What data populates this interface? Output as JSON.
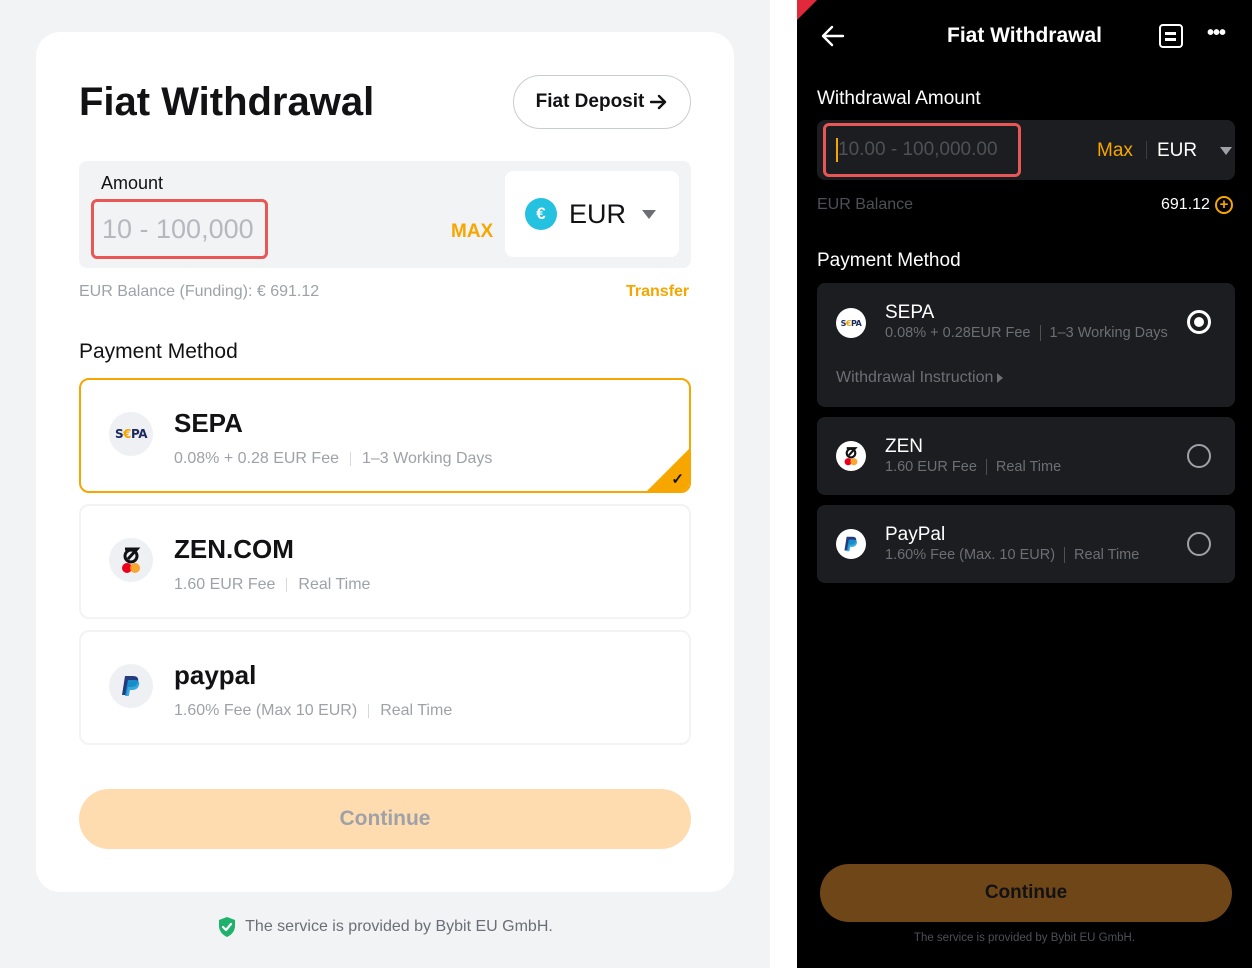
{
  "desktop": {
    "title": "Fiat Withdrawal",
    "deposit_button": "Fiat Deposit",
    "amount_label": "Amount",
    "amount_placeholder": "10 - 100,000",
    "max_label": "MAX",
    "currency_symbol": "€",
    "currency": "EUR",
    "balance_text": "EUR Balance (Funding): € 691.12",
    "transfer_link": "Transfer",
    "payment_method_title": "Payment Method",
    "methods": [
      {
        "name": "SEPA",
        "fee": "0.08% + 0.28 EUR Fee",
        "time": "1–3 Working Days",
        "selected": true,
        "icon": "sepa-logo-icon"
      },
      {
        "name": "ZEN.COM",
        "fee": "1.60 EUR Fee",
        "time": "Real Time",
        "selected": false,
        "icon": "zen-logo-icon"
      },
      {
        "name": "paypal",
        "fee": "1.60% Fee (Max 10 EUR)",
        "time": "Real Time",
        "selected": false,
        "icon": "paypal-logo-icon"
      }
    ],
    "continue_button": "Continue",
    "footer": "The service is provided by Bybit EU GmbH.",
    "accent_color": "#f7a600"
  },
  "mobile": {
    "title": "Fiat Withdrawal",
    "withdrawal_amount_label": "Withdrawal Amount",
    "amount_placeholder": "10.00 - 100,000.00",
    "max_label": "Max",
    "currency": "EUR",
    "balance_label": "EUR Balance",
    "balance_value": "691.12",
    "payment_method_title": "Payment Method",
    "methods": [
      {
        "name": "SEPA",
        "fee": "0.08% + 0.28EUR Fee",
        "time": "1–3 Working Days",
        "selected": true,
        "instruction": "Withdrawal Instruction",
        "icon": "sepa-logo-icon"
      },
      {
        "name": "ZEN",
        "fee": "1.60 EUR Fee",
        "time": "Real Time",
        "selected": false,
        "icon": "zen-logo-icon"
      },
      {
        "name": "PayPal",
        "fee": "1.60%  Fee (Max. 10 EUR)",
        "time": "Real Time",
        "selected": false,
        "icon": "paypal-logo-icon"
      }
    ],
    "continue_button": "Continue",
    "footer": "The service is provided by Bybit EU GmbH."
  }
}
